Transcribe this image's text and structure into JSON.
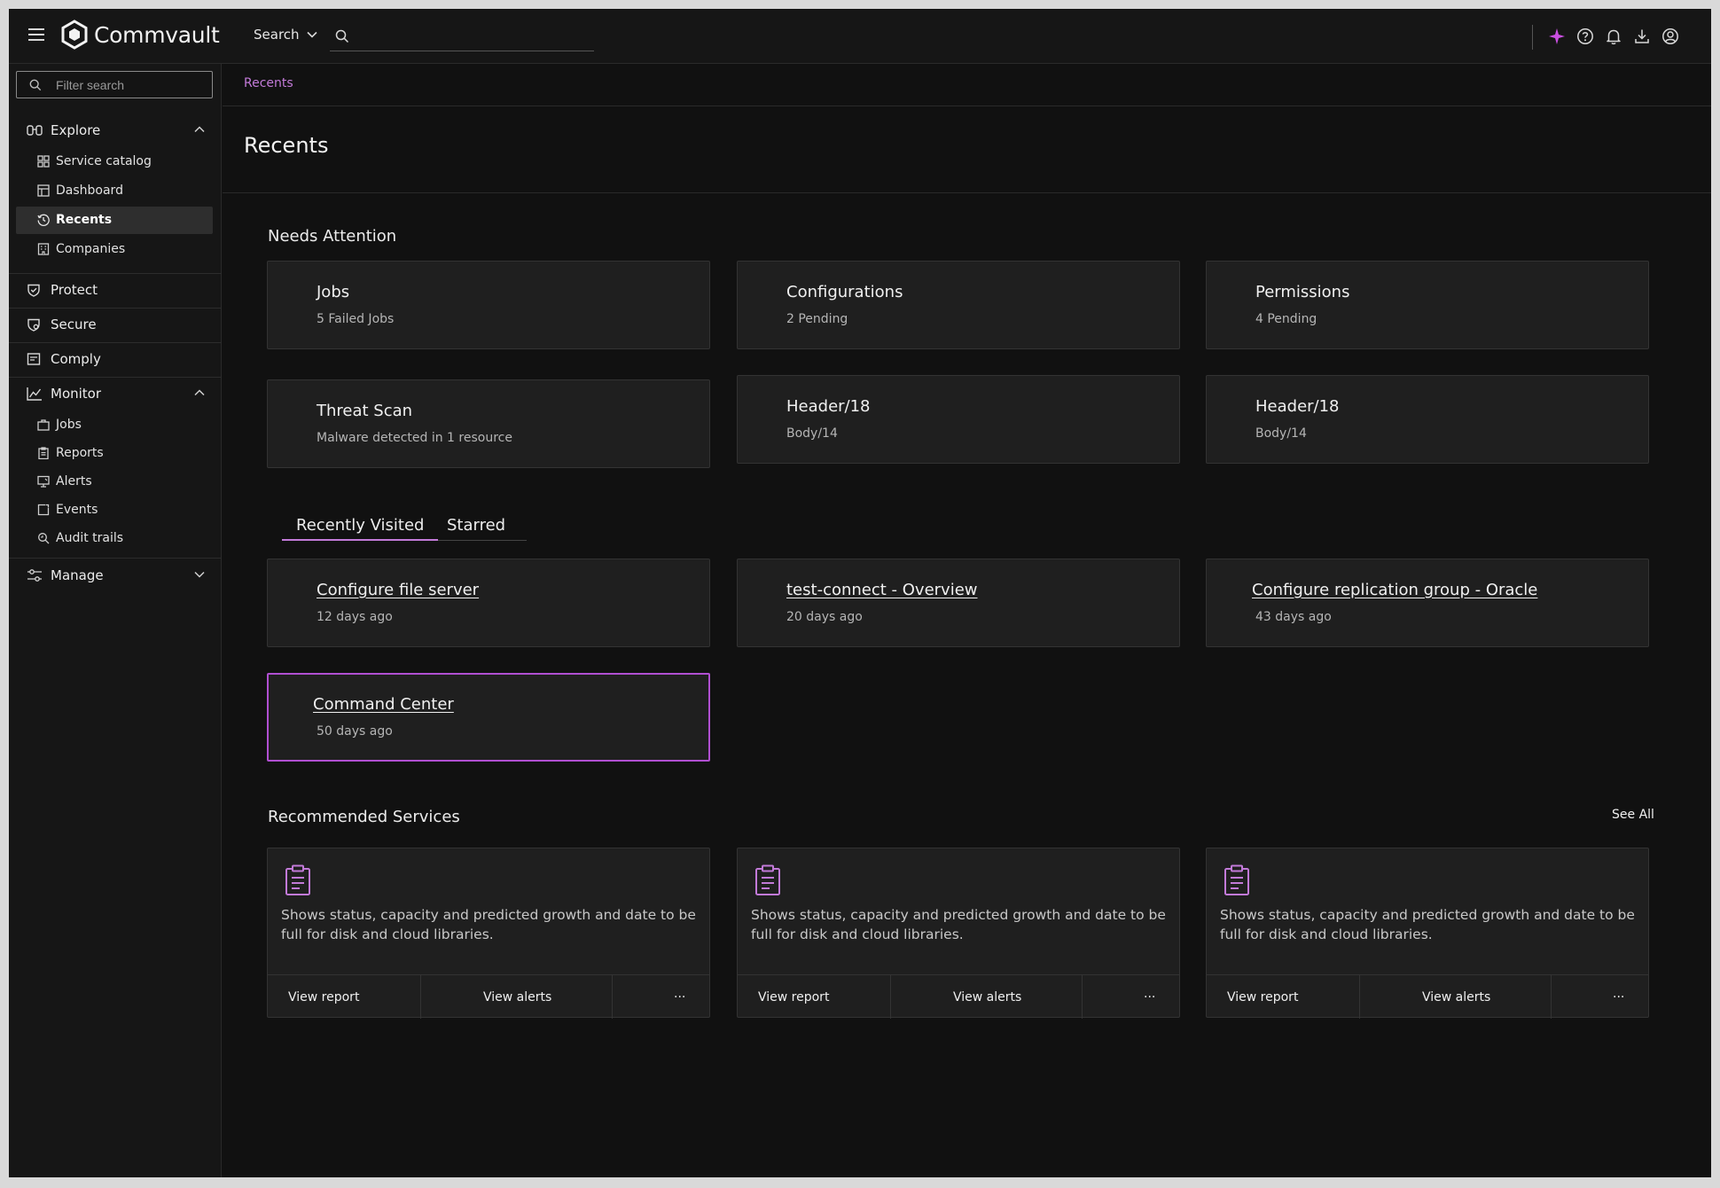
{
  "app": {
    "brand": "Commvault",
    "accent_color": "#c27ad8"
  },
  "topbar": {
    "search_scope": "Search",
    "search_placeholder": "",
    "icons": [
      "ai-sparkle-icon",
      "help-icon",
      "bell-icon",
      "download-icon",
      "user-icon"
    ]
  },
  "sidebar": {
    "filter_placeholder": "Filter search",
    "explore": {
      "label": "Explore",
      "items": [
        {
          "label": "Service catalog",
          "icon": "grid-icon"
        },
        {
          "label": "Dashboard",
          "icon": "dashboard-icon"
        },
        {
          "label": "Recents",
          "icon": "history-icon",
          "active": true
        },
        {
          "label": "Companies",
          "icon": "building-icon"
        }
      ]
    },
    "protect": {
      "label": "Protect"
    },
    "secure": {
      "label": "Secure"
    },
    "comply": {
      "label": "Comply"
    },
    "monitor": {
      "label": "Monitor",
      "items": [
        {
          "label": "Jobs",
          "icon": "briefcase-icon"
        },
        {
          "label": "Reports",
          "icon": "report-icon"
        },
        {
          "label": "Alerts",
          "icon": "alert-icon"
        },
        {
          "label": "Events",
          "icon": "event-icon"
        },
        {
          "label": "Audit trails",
          "icon": "audit-icon"
        }
      ]
    },
    "manage": {
      "label": "Manage"
    }
  },
  "main": {
    "breadcrumb": "Recents",
    "title": "Recents",
    "needs_attention": {
      "title": "Needs Attention",
      "cards": [
        {
          "title": "Jobs",
          "subtitle": "5 Failed Jobs"
        },
        {
          "title": "Configurations",
          "subtitle": "2 Pending"
        },
        {
          "title": "Permissions",
          "subtitle": "4 Pending"
        },
        {
          "title": "Threat Scan",
          "subtitle": "Malware detected in 1 resource"
        },
        {
          "title": "Header/18",
          "subtitle": "Body/14"
        },
        {
          "title": "Header/18",
          "subtitle": "Body/14"
        }
      ]
    },
    "tabs": {
      "recently_visited": "Recently Visited",
      "starred": "Starred"
    },
    "recent": [
      {
        "title": "Configure file server",
        "time": "12 days ago"
      },
      {
        "title": "test-connect - Overview",
        "time": "20 days ago"
      },
      {
        "title": "Configure replication group - Oracle",
        "time": "43 days ago"
      },
      {
        "title": "Command Center",
        "time": "50 days ago"
      }
    ],
    "recommended": {
      "title": "Recommended Services",
      "see_all": "See All",
      "cards": [
        {
          "description": "Shows status, capacity and predicted growth and date to be full for disk and cloud libraries.",
          "view_report": "View report",
          "view_alerts": "View alerts",
          "more": "···"
        },
        {
          "description": "Shows status, capacity and predicted growth and date to be full for disk and cloud libraries.",
          "view_report": "View report",
          "view_alerts": "View alerts",
          "more": "···"
        },
        {
          "description": "Shows status, capacity and predicted growth and date to be full for disk and cloud libraries.",
          "view_report": "View report",
          "view_alerts": "View alerts",
          "more": "···"
        }
      ]
    }
  }
}
